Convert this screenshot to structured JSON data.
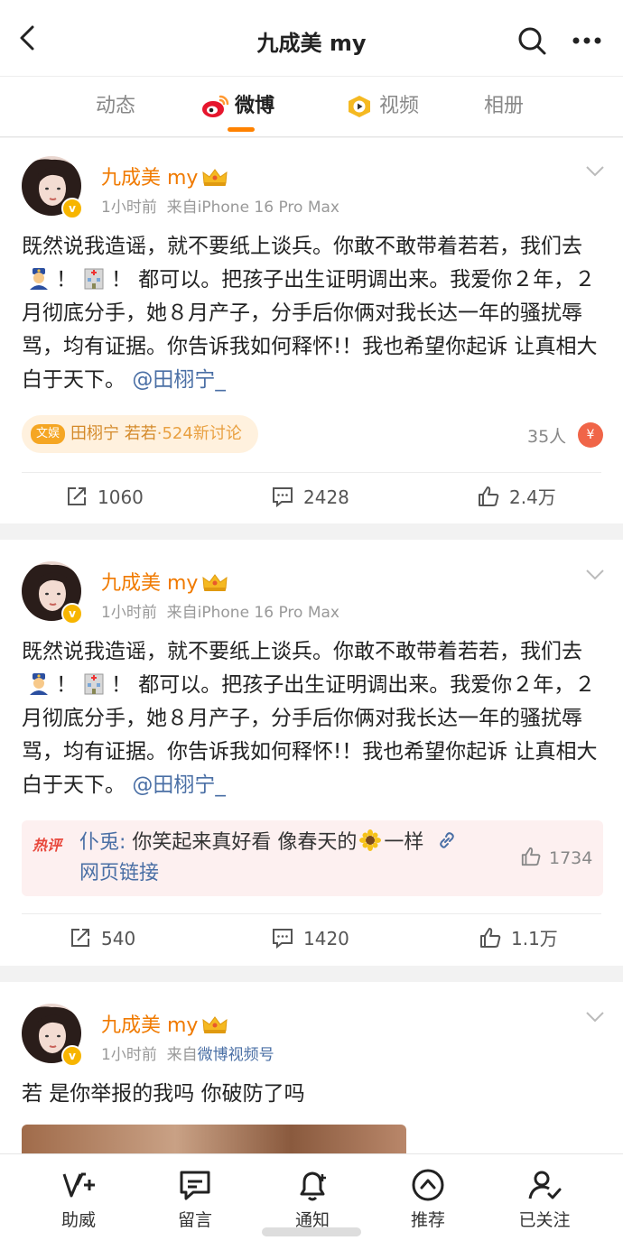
{
  "header": {
    "title": "九成美 my",
    "back_icon": "chevron-left-icon",
    "search_icon": "search-icon",
    "more_icon": "more-dots-icon"
  },
  "tabs": [
    {
      "label": "动态"
    },
    {
      "label": "微博",
      "icon": "weibo-icon"
    },
    {
      "label": "视频",
      "icon": "video-icon"
    },
    {
      "label": "相册"
    }
  ],
  "colors": {
    "accent": "#ff8200",
    "username": "#f07a00",
    "link": "#4a6fa5"
  },
  "posts": [
    {
      "username": "九成美 my",
      "time": "1小时前",
      "source_prefix": "来自",
      "source": "iPhone 16 Pro Max",
      "text_1": "既然说我造谣，就不要纸上谈兵。你敢不敢带着若若，我们去",
      "text_2": "！",
      "text_3": "！ 都可以。把孩子出生证明调出来。我爱你２年，２月彻底分手，她８月产子，分手后你俩对我长达一年的骚扰辱骂，均有证据。你告诉我如何释怀!！我也希望你起诉 让真相大白于天下。",
      "mention": "@田栩宁_",
      "topic_tag": "文娱",
      "topic_name": "田栩宁 若若",
      "topic_count": "·524新讨论",
      "people": "35人",
      "reposts": "1060",
      "comments": "2428",
      "likes": "2.4万"
    },
    {
      "username": "九成美 my",
      "time": "1小时前",
      "source_prefix": "来自",
      "source": "iPhone 16 Pro Max",
      "text_1": "既然说我造谣，就不要纸上谈兵。你敢不敢带着若若，我们去",
      "text_2": "！",
      "text_3": "！ 都可以。把孩子出生证明调出来。我爱你２年，２月彻底分手，她８月产子，分手后你俩对我长达一年的骚扰辱骂，均有证据。你告诉我如何释怀!！我也希望你起诉 让真相大白于天下。",
      "mention": "@田栩宁_",
      "hot_label": "热评",
      "hot_user": "仆兎:",
      "hot_text_a": "你笑起来真好看 像春天的",
      "hot_text_b": "一样",
      "hot_link": "网页链接",
      "hot_likes": "1734",
      "reposts": "540",
      "comments": "1420",
      "likes": "1.1万"
    },
    {
      "username": "九成美 my",
      "time": "1小时前",
      "source_prefix": "来自",
      "source": "微博视频号",
      "text": "若 是你举报的我吗 你破防了吗"
    }
  ],
  "bottom_nav": [
    {
      "label": "助威",
      "icon": "cheer-icon"
    },
    {
      "label": "留言",
      "icon": "message-icon"
    },
    {
      "label": "通知",
      "icon": "bell-icon"
    },
    {
      "label": "推荐",
      "icon": "recommend-icon"
    },
    {
      "label": "已关注",
      "icon": "followed-icon"
    }
  ]
}
